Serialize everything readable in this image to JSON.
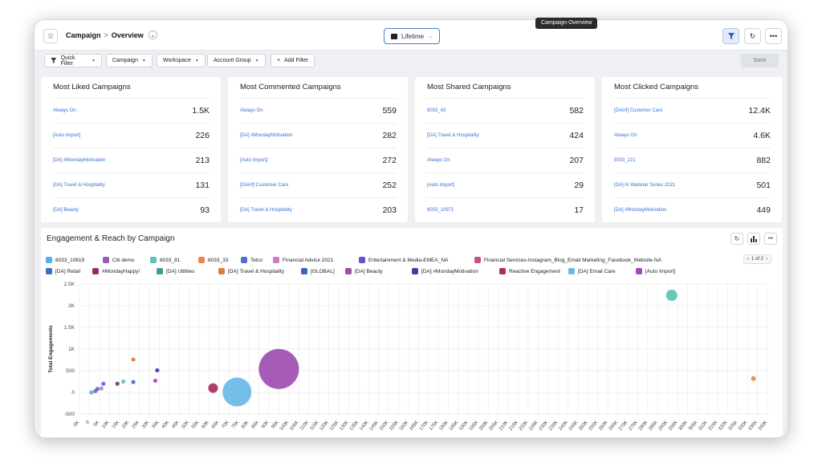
{
  "tooltip": "Campaign-Overview",
  "header": {
    "crumb_root": "Campaign",
    "crumb_sep": ">",
    "crumb_page": "Overview",
    "date_range": "Lifetime"
  },
  "filters": {
    "quick_filter": "Quick Filter",
    "campaign": "Campaign",
    "workspace": "Workspace",
    "account_group": "Account Group",
    "add_filter": "Add Filter",
    "save": "Save"
  },
  "cards": [
    {
      "title": "Most Liked Campaigns",
      "rows": [
        {
          "name": "Always On",
          "value": "1.5K"
        },
        {
          "name": "[Auto Import]",
          "value": "226"
        },
        {
          "name": "[DA] #MondayMotivation",
          "value": "213"
        },
        {
          "name": "[DA] Travel & Hospitality",
          "value": "131"
        },
        {
          "name": "[DA] Beauty",
          "value": "93"
        }
      ]
    },
    {
      "title": "Most Commented Campaigns",
      "rows": [
        {
          "name": "Always On",
          "value": "559"
        },
        {
          "name": "[DA] #MondayMotivation",
          "value": "282"
        },
        {
          "name": "[Auto Import]",
          "value": "272"
        },
        {
          "name": "[DAinf] Customer Care",
          "value": "252"
        },
        {
          "name": "[DA] Travel & Hospitality",
          "value": "203"
        }
      ]
    },
    {
      "title": "Most Shared Campaigns",
      "rows": [
        {
          "name": "8033_43",
          "value": "582"
        },
        {
          "name": "[DA] Travel & Hospitality",
          "value": "424"
        },
        {
          "name": "Always On",
          "value": "207"
        },
        {
          "name": "[Auto Import]",
          "value": "29"
        },
        {
          "name": "8033_10971",
          "value": "17"
        }
      ]
    },
    {
      "title": "Most Clicked Campaigns",
      "rows": [
        {
          "name": "[DAinf] Customer Care",
          "value": "12.4K"
        },
        {
          "name": "Always On",
          "value": "4.6K"
        },
        {
          "name": "8033_221",
          "value": "882"
        },
        {
          "name": "[DA] AI Webinar Series 2021",
          "value": "501"
        },
        {
          "name": "[DA] #MondayMotivation",
          "value": "449"
        }
      ]
    }
  ],
  "panel": {
    "title": "Engagement & Reach by Campaign",
    "pager": "1 of 2"
  },
  "legend": [
    {
      "label": "8033_10819",
      "color": "#5aaee6"
    },
    {
      "label": "Citi demo",
      "color": "#9b59b6"
    },
    {
      "label": "8033_81",
      "color": "#5cc3b8"
    },
    {
      "label": "8033_33",
      "color": "#e8884a"
    },
    {
      "label": "Telco",
      "color": "#4a74d0"
    },
    {
      "label": "Financial Advice 2021",
      "color": "#c97ac9"
    },
    {
      "label": "Entertainment & Media-EMEA_NA",
      "color": "#6a52c9"
    },
    {
      "label": "Financial Services-Instagram_Blog_Email Marketing_Facebook_Website-NA",
      "color": "#c7508a"
    },
    {
      "label": "[DA] Retail",
      "color": "#3f6fc4"
    },
    {
      "label": "#MondayHappy!",
      "color": "#8a3070"
    },
    {
      "label": "[DA] Utilities",
      "color": "#3d9c92"
    },
    {
      "label": "[DA] Travel & Hospitality",
      "color": "#e07b3a"
    },
    {
      "label": "[GLOBAL]",
      "color": "#3a65b8"
    },
    {
      "label": "[DA] Beauty",
      "color": "#a04ea6"
    },
    {
      "label": "[DA] #MondayMotivation",
      "color": "#4b3a9a"
    },
    {
      "label": "Reactive Engagement",
      "color": "#a82e5e"
    },
    {
      "label": "[DA] Email Care",
      "color": "#6ab8e8"
    },
    {
      "label": "[Auto Import]",
      "color": "#9e4db3"
    }
  ],
  "chart_data": {
    "type": "scatter",
    "ylabel": "Total Engagements",
    "xlim": [
      -5000,
      340000
    ],
    "ylim": [
      -500,
      2500
    ],
    "x_ticks": [
      "-5K",
      "0",
      "5K",
      "10K",
      "15K",
      "20K",
      "25K",
      "30K",
      "35K",
      "40K",
      "45K",
      "50K",
      "55K",
      "60K",
      "65K",
      "70K",
      "75K",
      "80K",
      "85K",
      "90K",
      "95K",
      "100K",
      "105K",
      "110K",
      "115K",
      "120K",
      "125K",
      "130K",
      "135K",
      "140K",
      "145K",
      "150K",
      "155K",
      "160K",
      "165K",
      "170K",
      "175K",
      "180K",
      "185K",
      "190K",
      "195K",
      "200K",
      "205K",
      "210K",
      "215K",
      "220K",
      "225K",
      "230K",
      "235K",
      "240K",
      "245K",
      "250K",
      "255K",
      "260K",
      "265K",
      "270K",
      "275K",
      "280K",
      "285K",
      "290K",
      "295K",
      "300K",
      "305K",
      "310K",
      "315K",
      "320K",
      "325K",
      "330K",
      "335K",
      "340K"
    ],
    "y_ticks": [
      "-500",
      "0",
      "500",
      "1K",
      "1.5K",
      "2K",
      "2.5K"
    ],
    "grid": true,
    "points": [
      {
        "x": 1000,
        "y": 0,
        "size": 2,
        "color": "#5aaee6"
      },
      {
        "x": 3000,
        "y": 30,
        "size": 2,
        "color": "#9b59b6"
      },
      {
        "x": 4000,
        "y": 80,
        "size": 2,
        "color": "#4a74d0"
      },
      {
        "x": 6000,
        "y": 90,
        "size": 2,
        "color": "#c97ac9"
      },
      {
        "x": 7000,
        "y": 200,
        "size": 2,
        "color": "#4a74d0"
      },
      {
        "x": 14000,
        "y": 200,
        "size": 2,
        "color": "#8a3070"
      },
      {
        "x": 17000,
        "y": 250,
        "size": 2,
        "color": "#5cc3b8"
      },
      {
        "x": 22000,
        "y": 240,
        "size": 4,
        "color": "#3f6fc4"
      },
      {
        "x": 22000,
        "y": 760,
        "size": 2,
        "color": "#e07b3a"
      },
      {
        "x": 33000,
        "y": 270,
        "size": 2,
        "color": "#a04ea6"
      },
      {
        "x": 34000,
        "y": 510,
        "size": 2,
        "color": "#4b3a9a"
      },
      {
        "x": 62000,
        "y": 100,
        "size": 12,
        "color": "#a82e5e"
      },
      {
        "x": 74000,
        "y": 10,
        "size": 36,
        "color": "#6ab8e8"
      },
      {
        "x": 95000,
        "y": 540,
        "size": 50,
        "color": "#9e4db3"
      },
      {
        "x": 292000,
        "y": 2240,
        "size": 14,
        "color": "#5cc3b8"
      },
      {
        "x": 333000,
        "y": 320,
        "size": 6,
        "color": "#e8884a"
      }
    ]
  }
}
